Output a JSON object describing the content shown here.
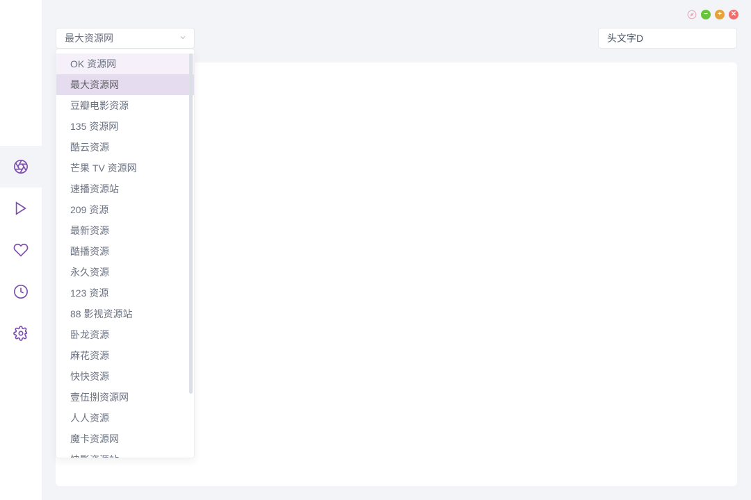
{
  "sidebar": {
    "items": [
      {
        "name": "aperture",
        "active": true
      },
      {
        "name": "play",
        "active": false
      },
      {
        "name": "heart",
        "active": false
      },
      {
        "name": "clock",
        "active": false
      },
      {
        "name": "settings",
        "active": false
      }
    ]
  },
  "windowControls": [
    "pin",
    "min",
    "max",
    "close"
  ],
  "search": {
    "value": "头文字D"
  },
  "sourceSelector": {
    "selectedLabel": "最大资源网",
    "selectedIndex": 1,
    "hoverIndex": 0,
    "options": [
      "OK 资源网",
      "最大资源网",
      "豆瓣电影资源",
      "135 资源网",
      "酷云资源",
      "芒果 TV 资源网",
      "速播资源站",
      "209 资源",
      "最新资源",
      "酷播资源",
      "永久资源",
      "123 资源",
      "88 影视资源站",
      "卧龙资源",
      "麻花资源",
      "快快资源",
      "壹伍捌资源网",
      "人人资源",
      "魔卡资源网",
      "快影资源站"
    ]
  }
}
